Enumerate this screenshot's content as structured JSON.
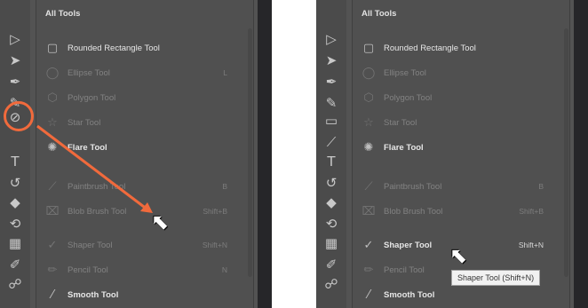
{
  "left_panel": {
    "title": "All Tools",
    "tools": [
      {
        "label": "Rounded Rectangle Tool",
        "shortcut": "",
        "icon": "rounded-rect-icon",
        "dim": false
      },
      {
        "label": "Ellipse Tool",
        "shortcut": "L",
        "icon": "ellipse-icon",
        "dim": true
      },
      {
        "label": "Polygon Tool",
        "shortcut": "",
        "icon": "polygon-icon",
        "dim": true
      },
      {
        "label": "Star Tool",
        "shortcut": "",
        "icon": "star-icon",
        "dim": true
      },
      {
        "label": "Flare Tool",
        "shortcut": "",
        "icon": "flare-icon",
        "dim": false
      },
      {
        "label": "Paintbrush Tool",
        "shortcut": "B",
        "icon": "paintbrush-icon",
        "dim": true
      },
      {
        "label": "Blob Brush Tool",
        "shortcut": "Shift+B",
        "icon": "blob-brush-icon",
        "dim": true
      },
      {
        "label": "Shaper Tool",
        "shortcut": "Shift+N",
        "icon": "shaper-icon",
        "dim": true
      },
      {
        "label": "Pencil Tool",
        "shortcut": "N",
        "icon": "pencil-icon",
        "dim": true
      },
      {
        "label": "Smooth Tool",
        "shortcut": "",
        "icon": "smooth-icon",
        "dim": false
      }
    ]
  },
  "right_panel": {
    "title": "All Tools",
    "tools": [
      {
        "label": "Rounded Rectangle Tool",
        "shortcut": "",
        "icon": "rounded-rect-icon",
        "dim": false
      },
      {
        "label": "Ellipse Tool",
        "shortcut": "",
        "icon": "ellipse-icon",
        "dim": true
      },
      {
        "label": "Polygon Tool",
        "shortcut": "",
        "icon": "polygon-icon",
        "dim": true
      },
      {
        "label": "Star Tool",
        "shortcut": "",
        "icon": "star-icon",
        "dim": true
      },
      {
        "label": "Flare Tool",
        "shortcut": "",
        "icon": "flare-icon",
        "dim": false
      },
      {
        "label": "Paintbrush Tool",
        "shortcut": "B",
        "icon": "paintbrush-icon",
        "dim": true
      },
      {
        "label": "Blob Brush Tool",
        "shortcut": "Shift+B",
        "icon": "blob-brush-icon",
        "dim": true
      },
      {
        "label": "Shaper Tool",
        "shortcut": "Shift+N",
        "icon": "shaper-icon",
        "dim": false
      },
      {
        "label": "Pencil Tool",
        "shortcut": "",
        "icon": "pencil-icon",
        "dim": true
      },
      {
        "label": "Smooth Tool",
        "shortcut": "",
        "icon": "smooth-icon",
        "dim": false
      }
    ],
    "tooltip": "Shaper Tool (Shift+N)"
  },
  "colors": {
    "panel_bg": "#535353",
    "flyout_bg": "#505050",
    "highlight_orange": "#f16a3c"
  }
}
